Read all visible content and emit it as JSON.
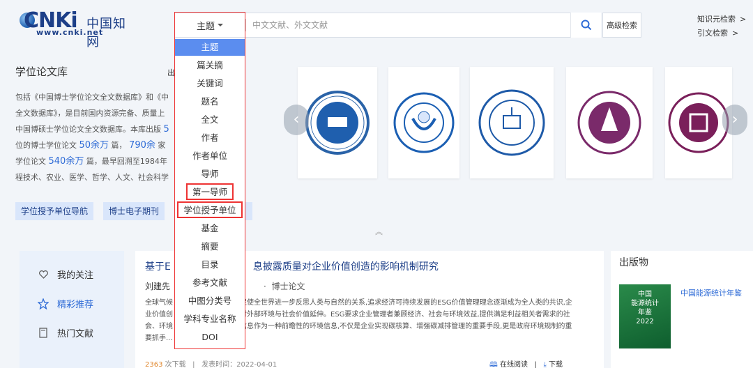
{
  "header": {
    "logo_text": "CNKi",
    "logo_cn": "中国知网",
    "logo_url": "www.cnki.net",
    "search_placeholder": "中文文献、外文文献",
    "advanced_search": "高级检索",
    "links": [
      "知识元检索",
      "引文检索"
    ],
    "link_arrow": ">"
  },
  "dropdown": {
    "current": "主题",
    "items": [
      "主题",
      "篇关摘",
      "关键词",
      "题名",
      "全文",
      "作者",
      "作者单位",
      "导师",
      "第一导师",
      "学位授予单位",
      "基金",
      "摘要",
      "目录",
      "参考文献",
      "中图分类号",
      "学科专业名称",
      "DOI"
    ],
    "selected_index": 0,
    "highlighted_indexes": [
      8,
      9
    ]
  },
  "library": {
    "title": "学位论文库",
    "title_more": "出",
    "desc": {
      "p1": "包括《中国博士学位论文全文数据库》和《中",
      "p2": "全文数据库》，是目前国内资源完备、质量上",
      "p3a": "中国博硕士学位论文全文数据库。本库出版",
      "p3b": "5",
      "p4a": "位的博士学位论文",
      "n1": "50余万",
      "p4b": "篇，",
      "n2": "790余",
      "p4c": "家",
      "p5a": "学位论文",
      "n3": "540余万",
      "p5b": "篇，最早回溯至1984年",
      "p6": "程技术、农业、医学、哲学、人文、社会科学"
    },
    "buttons": [
      "学位授予单位导航",
      "博士电子期刊"
    ]
  },
  "sidebar": {
    "items": [
      "我的关注",
      "精彩推荐",
      "热门文献"
    ],
    "active_index": 1
  },
  "article": {
    "title_start": "基于E",
    "title_end": "息披露质量对企业价值创造的影响机制研究",
    "author": "刘建先",
    "type": "博士论文",
    "abstract_lines": [
      "全球气候",
      "促使全世界进一步反思人类与自然的关系,追求经济可持续发展的ESG价值管理理念逐渐成为全人类的共识,企",
      "业价值创",
      "对外部环境与社会价值延伸。ESG要求企业管理者兼顾经济、社会与环境效益,提供满足利益相关者需求的社",
      "会、环境",
      "信息作为一种前瞻性的环境信息,不仅是企业实现碳核算、增强碳减排管理的重要手段,更是政府环境规制的重",
      "要抓手..."
    ],
    "download_count": "2363",
    "download_label": "次下载",
    "publish_label": "发表时间：",
    "publish_date": "2022-04-01",
    "read_online": "在线阅读",
    "download": "下载"
  },
  "publications": {
    "title": "出版物",
    "book_title": "中国能源统计年鉴",
    "book_cover_lines": [
      "中国",
      "能源统计",
      "年鉴",
      "2022"
    ]
  },
  "colors": {
    "accent": "#2e6bd6",
    "selected": "#5b8def",
    "highlight_border": "#ee3333"
  }
}
